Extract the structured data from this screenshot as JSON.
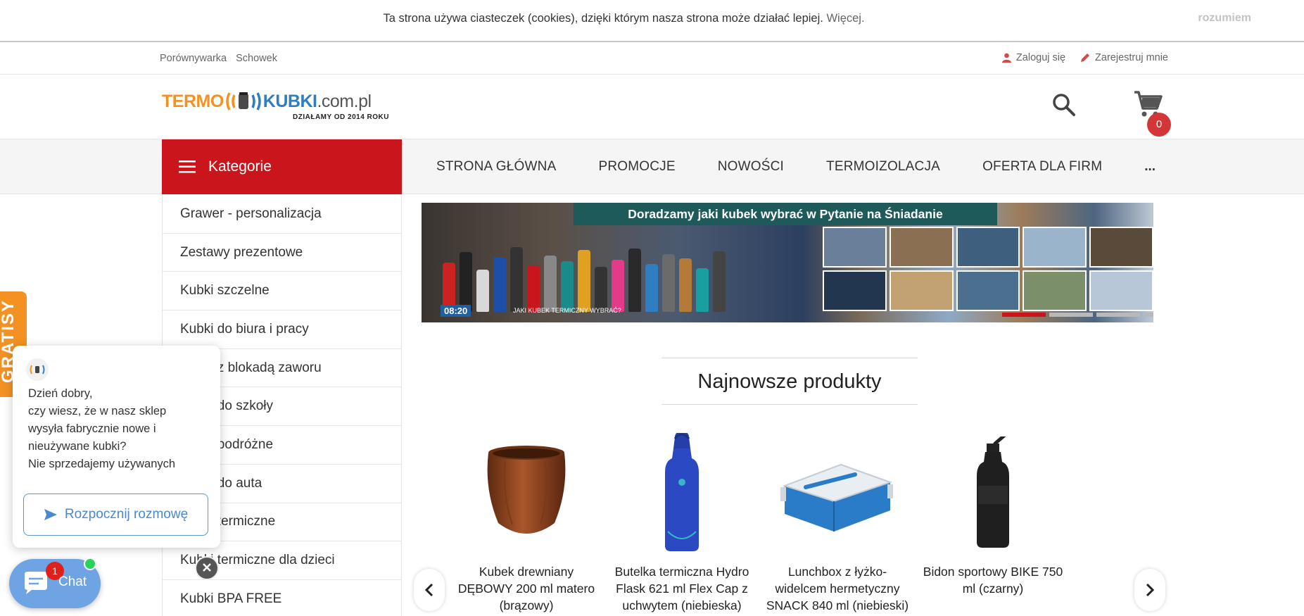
{
  "cookie_bar": {
    "text": "Ta strona używa ciasteczek (cookies), dzięki którym nasza strona może działać lepiej.",
    "more_link": "Więcej.",
    "accept_label": "rozumiem"
  },
  "top_links": {
    "left": [
      "Porównywarka",
      "Schowek"
    ],
    "login_label": "Zaloguj się",
    "register_label": "Zarejestruj mnie"
  },
  "header": {
    "logo": {
      "part1": "TERMO",
      "part2": "KUBKI",
      "part3": ".com.pl",
      "tagline": "DZIAŁAMY OD 2014 ROKU"
    },
    "cart_count": "0"
  },
  "nav": {
    "categories_label": "Kategorie",
    "items": [
      "STRONA GŁÓWNA",
      "PROMOCJE",
      "NOWOŚCI",
      "TERMOIZOLACJA",
      "OFERTA DLA FIRM"
    ],
    "more_label": "..."
  },
  "sidebar": {
    "items": [
      "Grawer - personalizacja",
      "Zestawy prezentowe",
      "Kubki szczelne",
      "Kubki do biura i pracy",
      "Kubki z blokadą zaworu",
      "Kubki do szkoły",
      "Kubki podróżne",
      "Kubki do auta",
      "Kubki termiczne",
      "Kubki termiczne dla dzieci",
      "Kubki BPA FREE"
    ]
  },
  "banner": {
    "title": "Doradzamy jaki kubek wybrać w Pytanie na Śniadanie",
    "clock": "08:20",
    "caption": "JAKI KUBEK TERMICZNY WYBRAĆ?",
    "slides_count": 4,
    "active_slide": 1
  },
  "section": {
    "title": "Najnowsze produkty"
  },
  "products": [
    {
      "name": "Kubek drewniany DĘBOWY 200 ml matero (brązowy)"
    },
    {
      "name": "Butelka termiczna Hydro Flask 621 ml Flex Cap z uchwytem (niebieska)"
    },
    {
      "name": "Lunchbox z łyżko-widelcem hermetyczny SNACK 840 ml (niebieski)"
    },
    {
      "name": "Bidon sportowy BIKE 750 ml (czarny)"
    }
  ],
  "side_tab": {
    "label": "GRATISY"
  },
  "chat": {
    "greeting": "Dzień dobry,",
    "line1": "czy wiesz, że w nasz sklep",
    "line2": "wysyła fabrycznie nowe i",
    "line3": "nieużywane kubki?",
    "line4": "Nie sprzedajemy używanych",
    "start_label": "Rozpocznij rozmowę",
    "button_label": "Chat",
    "unread": "1"
  },
  "colors": {
    "brand_red": "#c9151b",
    "brand_orange": "#f39222",
    "brand_blue": "#2f7ec2",
    "chat_blue": "#6ea4e4"
  }
}
